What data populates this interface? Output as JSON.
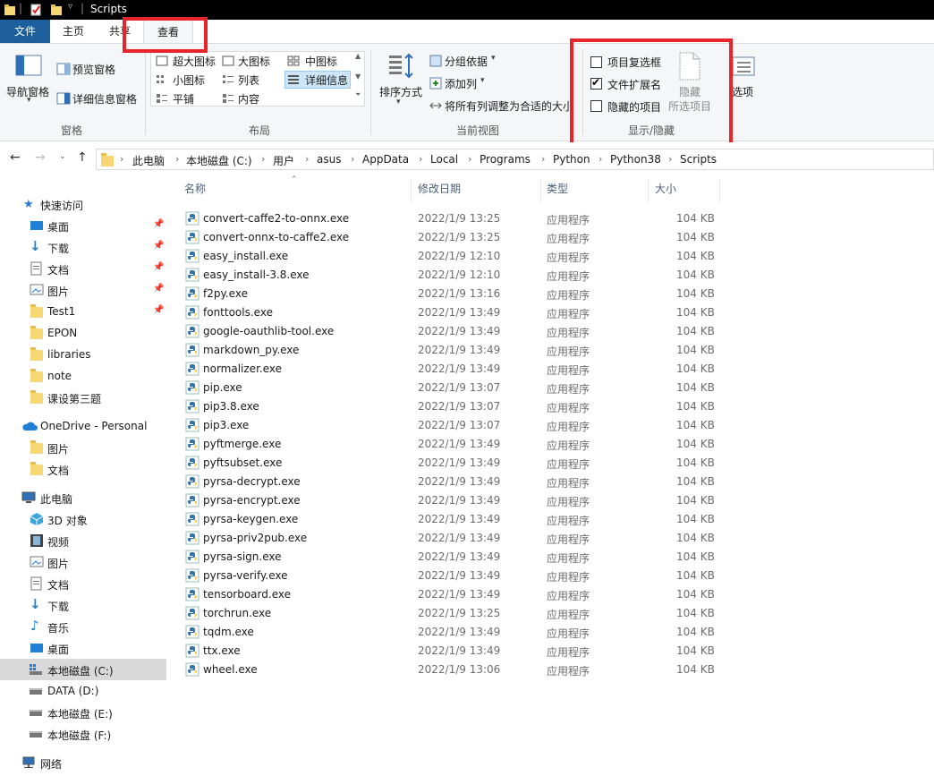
{
  "window": {
    "title": "Scripts"
  },
  "ribbon_tabs": [
    {
      "label": "文件"
    },
    {
      "label": "主页"
    },
    {
      "label": "共享"
    },
    {
      "label": "查看"
    }
  ],
  "ribbon": {
    "panes": {
      "navigation_pane": "导航窗格",
      "preview_pane": "预览窗格",
      "details_pane": "详细信息窗格",
      "group": "窗格"
    },
    "layout": {
      "items": [
        "超大图标",
        "大图标",
        "中图标",
        "小图标",
        "列表",
        "详细信息",
        "平铺",
        "内容"
      ],
      "group": "布局"
    },
    "current_view": {
      "sort_by": "排序方式",
      "group_by": "分组依据",
      "add_columns": "添加列",
      "size_all_columns": "将所有列调整为合适的大小",
      "group": "当前视图"
    },
    "show_hide": {
      "item_checkboxes": {
        "label": "项目复选框",
        "checked": false
      },
      "file_extensions": {
        "label": "文件扩展名",
        "checked": true
      },
      "hidden_items": {
        "label": "隐藏的项目",
        "checked": false
      },
      "hide_selected_1": "隐藏",
      "hide_selected_2": "所选项目",
      "group": "显示/隐藏"
    },
    "options": "选项"
  },
  "breadcrumb": [
    "此电脑",
    "本地磁盘 (C:)",
    "用户",
    "asus",
    "AppData",
    "Local",
    "Programs",
    "Python",
    "Python38",
    "Scripts"
  ],
  "nav": {
    "quick_access": "快速访问",
    "quick_items": [
      "桌面",
      "下载",
      "文档",
      "图片",
      "Test1",
      "EPON",
      "libraries",
      "note",
      "课设第三题"
    ],
    "onedrive": "OneDrive - Personal",
    "onedrive_items": [
      "图片",
      "文档"
    ],
    "this_pc": "此电脑",
    "pc_items": [
      "3D 对象",
      "视频",
      "图片",
      "文档",
      "下载",
      "音乐",
      "桌面",
      "本地磁盘 (C:)",
      "DATA (D:)",
      "本地磁盘 (E:)",
      "本地磁盘 (F:)"
    ],
    "network": "网络"
  },
  "columns": {
    "name": "名称",
    "date": "修改日期",
    "type": "类型",
    "size": "大小"
  },
  "files": [
    {
      "name": "convert-caffe2-to-onnx.exe",
      "date": "2022/1/9 13:25",
      "type": "应用程序",
      "size": "104 KB"
    },
    {
      "name": "convert-onnx-to-caffe2.exe",
      "date": "2022/1/9 13:25",
      "type": "应用程序",
      "size": "104 KB"
    },
    {
      "name": "easy_install.exe",
      "date": "2022/1/9 12:10",
      "type": "应用程序",
      "size": "104 KB"
    },
    {
      "name": "easy_install-3.8.exe",
      "date": "2022/1/9 12:10",
      "type": "应用程序",
      "size": "104 KB"
    },
    {
      "name": "f2py.exe",
      "date": "2022/1/9 13:16",
      "type": "应用程序",
      "size": "104 KB"
    },
    {
      "name": "fonttools.exe",
      "date": "2022/1/9 13:49",
      "type": "应用程序",
      "size": "104 KB"
    },
    {
      "name": "google-oauthlib-tool.exe",
      "date": "2022/1/9 13:49",
      "type": "应用程序",
      "size": "104 KB"
    },
    {
      "name": "markdown_py.exe",
      "date": "2022/1/9 13:49",
      "type": "应用程序",
      "size": "104 KB"
    },
    {
      "name": "normalizer.exe",
      "date": "2022/1/9 13:49",
      "type": "应用程序",
      "size": "104 KB"
    },
    {
      "name": "pip.exe",
      "date": "2022/1/9 13:07",
      "type": "应用程序",
      "size": "104 KB"
    },
    {
      "name": "pip3.8.exe",
      "date": "2022/1/9 13:07",
      "type": "应用程序",
      "size": "104 KB"
    },
    {
      "name": "pip3.exe",
      "date": "2022/1/9 13:07",
      "type": "应用程序",
      "size": "104 KB"
    },
    {
      "name": "pyftmerge.exe",
      "date": "2022/1/9 13:49",
      "type": "应用程序",
      "size": "104 KB"
    },
    {
      "name": "pyftsubset.exe",
      "date": "2022/1/9 13:49",
      "type": "应用程序",
      "size": "104 KB"
    },
    {
      "name": "pyrsa-decrypt.exe",
      "date": "2022/1/9 13:49",
      "type": "应用程序",
      "size": "104 KB"
    },
    {
      "name": "pyrsa-encrypt.exe",
      "date": "2022/1/9 13:49",
      "type": "应用程序",
      "size": "104 KB"
    },
    {
      "name": "pyrsa-keygen.exe",
      "date": "2022/1/9 13:49",
      "type": "应用程序",
      "size": "104 KB"
    },
    {
      "name": "pyrsa-priv2pub.exe",
      "date": "2022/1/9 13:49",
      "type": "应用程序",
      "size": "104 KB"
    },
    {
      "name": "pyrsa-sign.exe",
      "date": "2022/1/9 13:49",
      "type": "应用程序",
      "size": "104 KB"
    },
    {
      "name": "pyrsa-verify.exe",
      "date": "2022/1/9 13:49",
      "type": "应用程序",
      "size": "104 KB"
    },
    {
      "name": "tensorboard.exe",
      "date": "2022/1/9 13:49",
      "type": "应用程序",
      "size": "104 KB"
    },
    {
      "name": "torchrun.exe",
      "date": "2022/1/9 13:25",
      "type": "应用程序",
      "size": "104 KB"
    },
    {
      "name": "tqdm.exe",
      "date": "2022/1/9 13:49",
      "type": "应用程序",
      "size": "104 KB"
    },
    {
      "name": "ttx.exe",
      "date": "2022/1/9 13:49",
      "type": "应用程序",
      "size": "104 KB"
    },
    {
      "name": "wheel.exe",
      "date": "2022/1/9 13:06",
      "type": "应用程序",
      "size": "104 KB"
    }
  ],
  "colors": {
    "file_tab": "#1c5f9c",
    "highlight": "#e8242b",
    "selected_nav": "#d9d9d9"
  }
}
